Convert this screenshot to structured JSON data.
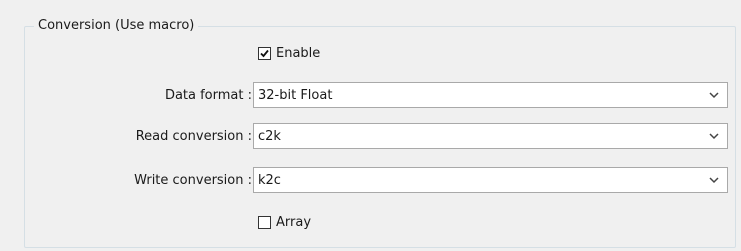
{
  "group": {
    "title": "Conversion (Use macro)"
  },
  "enable": {
    "label": "Enable",
    "checked": true
  },
  "fields": [
    {
      "label": "Data format :",
      "value": "32-bit Float"
    },
    {
      "label": "Read conversion :",
      "value": "c2k"
    },
    {
      "label": "Write conversion :",
      "value": "k2c"
    }
  ],
  "array": {
    "label": "Array",
    "checked": false
  },
  "icons": {
    "checkbox_check": "check-icon",
    "dropdown": "chevron-down-icon"
  }
}
